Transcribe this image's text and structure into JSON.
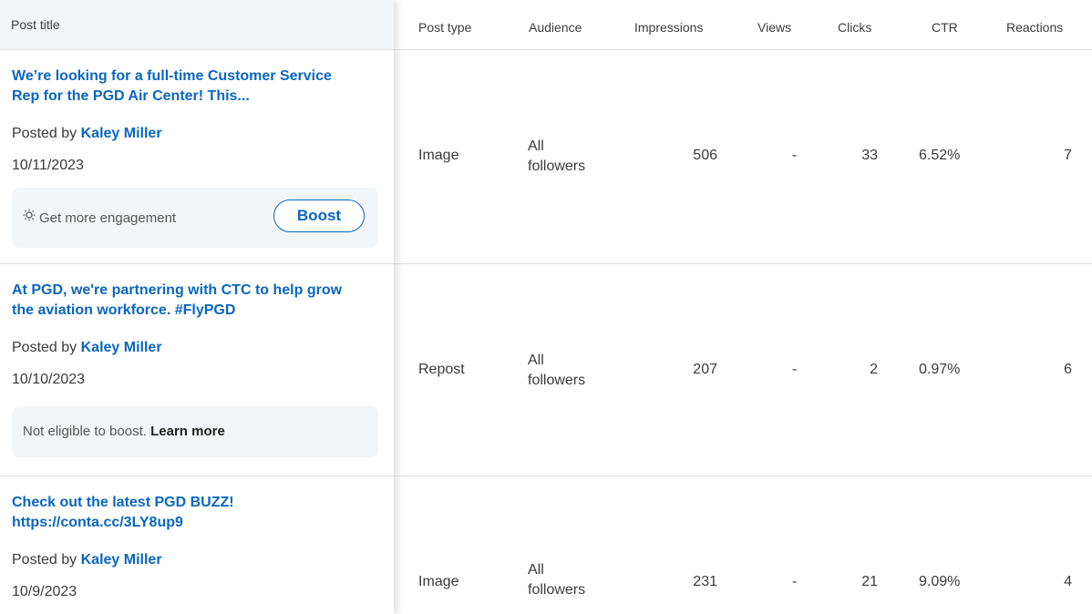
{
  "columns": {
    "post_title": "Post title",
    "post_type": "Post type",
    "audience": "Audience",
    "impressions": "Impressions",
    "views": "Views",
    "clicks": "Clicks",
    "ctr": "CTR",
    "reactions": "Reactions"
  },
  "posted_by_prefix": "Posted by",
  "rows": [
    {
      "title": "We’re looking for a full-time Customer Service Rep for the PGD Air Center! This...",
      "author": "Kaley Miller",
      "date": "10/11/2023",
      "engage_text": "Get more engagement",
      "boost_label": "Boost",
      "post_type": "Image",
      "audience_line1": "All",
      "audience_line2": "followers",
      "impressions": "506",
      "views": "-",
      "clicks": "33",
      "ctr": "6.52%",
      "reactions": "7"
    },
    {
      "title": "At PGD, we're partnering with CTC to help grow the aviation workforce. #FlyPGD",
      "author": "Kaley Miller",
      "date": "10/10/2023",
      "not_eligible_text": "Not eligible to boost.",
      "learn_more_label": "Learn more",
      "post_type": "Repost",
      "audience_line1": "All",
      "audience_line2": "followers",
      "impressions": "207",
      "views": "-",
      "clicks": "2",
      "ctr": "0.97%",
      "reactions": "6"
    },
    {
      "title": "Check out the latest PGD BUZZ! https://conta.cc/3LY8up9",
      "author": "Kaley Miller",
      "date": "10/9/2023",
      "post_type": "Image",
      "audience_line1": "All",
      "audience_line2": "followers",
      "impressions": "231",
      "views": "-",
      "clicks": "21",
      "ctr": "9.09%",
      "reactions": "4"
    }
  ],
  "icons": {
    "engagement": "lightbulb-icon"
  },
  "colors": {
    "link_blue": "#0a66c2",
    "header_bg": "#f3f6f8"
  }
}
